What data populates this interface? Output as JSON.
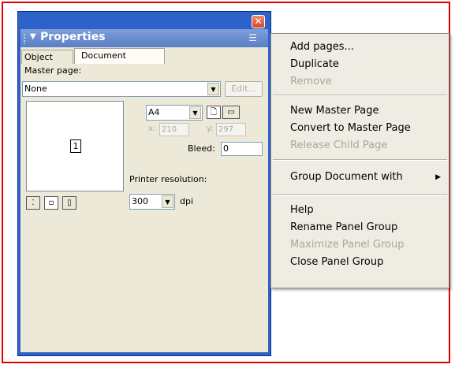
{
  "panel": {
    "title": "Properties",
    "tabs": [
      {
        "label": "Object"
      },
      {
        "label": "Document"
      }
    ],
    "document": {
      "master_page_label": "Master page:",
      "master_page_value": "None",
      "edit_label": "Edit...",
      "page_number": "1",
      "page_size": "A4",
      "x_label": "x:",
      "x_value": "210",
      "y_label": "y:",
      "y_value": "297",
      "bleed_label": "Bleed:",
      "bleed_value": "0",
      "printer_resolution_label": "Printer resolution:",
      "resolution_value": "300",
      "dpi_label": "dpi"
    }
  },
  "menu": {
    "items": [
      {
        "label": "Add pages...",
        "enabled": true
      },
      {
        "label": "Duplicate",
        "enabled": true
      },
      {
        "label": "Remove",
        "enabled": false
      },
      {
        "label": "New Master Page",
        "enabled": true
      },
      {
        "label": "Convert to Master Page",
        "enabled": true
      },
      {
        "label": "Release Child Page",
        "enabled": false
      },
      {
        "label": "Group Document with",
        "enabled": true,
        "submenu": true
      },
      {
        "label": "Help",
        "enabled": true
      },
      {
        "label": "Rename Panel Group",
        "enabled": true
      },
      {
        "label": "Maximize Panel Group",
        "enabled": false
      },
      {
        "label": "Close Panel Group",
        "enabled": true
      }
    ]
  },
  "icons": {
    "close": "close-icon",
    "options": "options-menu-icon",
    "portrait": "portrait-icon",
    "landscape": "landscape-icon",
    "submenu": "submenu-arrow-icon"
  },
  "colors": {
    "title_bar": "#2d63c8",
    "panel_header": "#6b8fd2",
    "highlight_frame": "#e00000",
    "menu_bg": "#efede3",
    "disabled_text": "#a9a795"
  }
}
